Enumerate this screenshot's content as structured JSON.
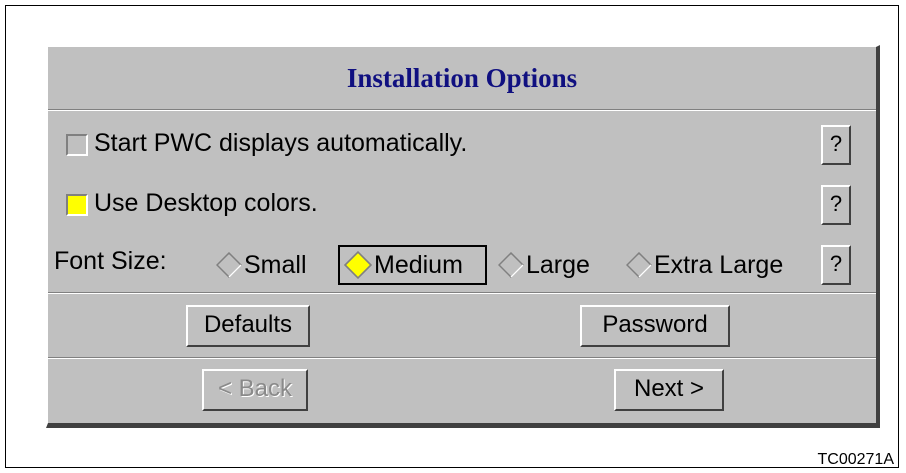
{
  "dialog": {
    "title": "Installation Options",
    "options": {
      "start_pwc_label": "Start PWC displays automatically.",
      "start_pwc_checked": false,
      "desktop_colors_label": "Use Desktop colors.",
      "desktop_colors_checked": true,
      "help_label": "?"
    },
    "font_size": {
      "label": "Font Size:",
      "choices": [
        "Small",
        "Medium",
        "Large",
        "Extra Large"
      ],
      "selected": "Medium"
    },
    "buttons": {
      "defaults": "Defaults",
      "password": "Password",
      "back": "< Back",
      "back_enabled": false,
      "next": "Next >"
    }
  },
  "caption": "TC00271A",
  "colors": {
    "panel": "#c0c0c0",
    "title": "#101080",
    "checked_fill": "#ffff00",
    "selected_radio_fill": "#ffff00"
  }
}
